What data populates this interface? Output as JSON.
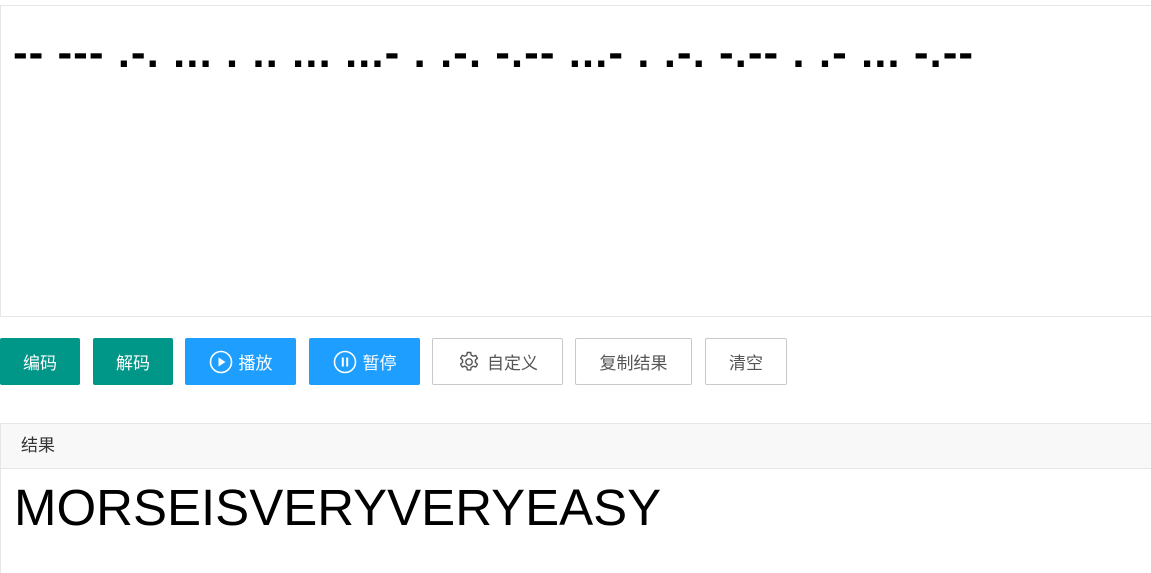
{
  "input": {
    "morse_text": "-- --- .-. ... . .. ... ...- . .-. -.-- ...- . .-. -.-- . .- ... -.--"
  },
  "toolbar": {
    "encode_label": "编码",
    "decode_label": "解码",
    "play_label": "播放",
    "pause_label": "暂停",
    "custom_label": "自定义",
    "copy_label": "复制结果",
    "clear_label": "清空"
  },
  "result": {
    "header_label": "结果",
    "text": "MORSEISVERYVERYEASY"
  },
  "colors": {
    "green": "#009688",
    "blue": "#1e9fff",
    "border": "#e6e6e6"
  },
  "icons": {
    "play": "play-circle-icon",
    "pause": "pause-circle-icon",
    "custom": "gear-icon"
  }
}
